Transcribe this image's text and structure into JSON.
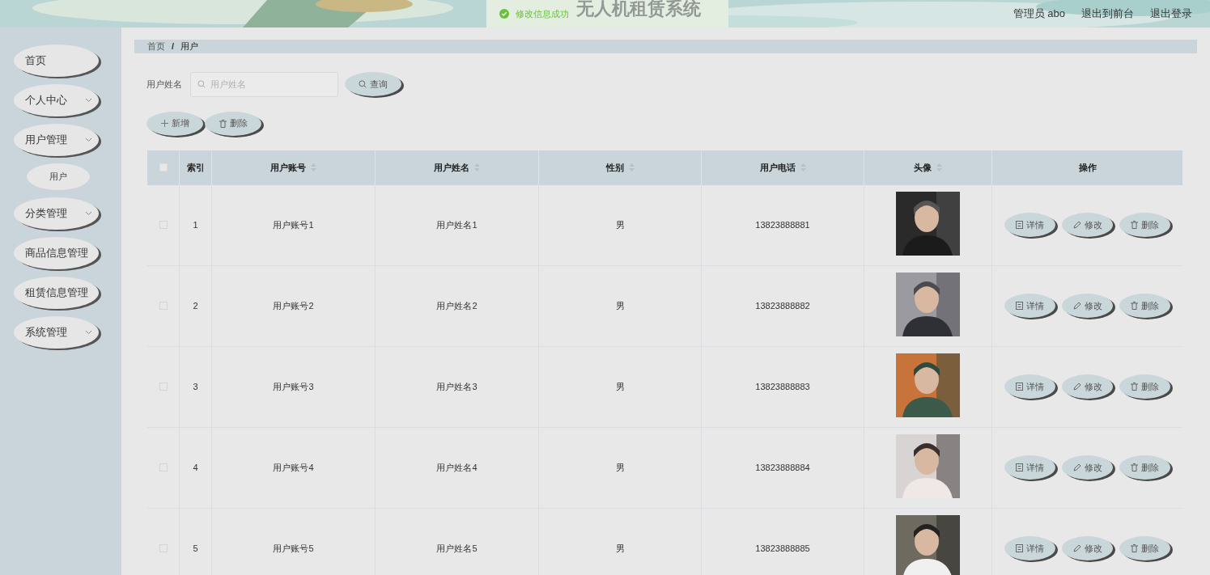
{
  "header": {
    "title": "无人机租赁系统",
    "toast": "修改信息成功",
    "links": [
      "管理员 abo",
      "退出到前台",
      "退出登录"
    ]
  },
  "sidebar": {
    "items": [
      {
        "label": "首页",
        "expandable": false
      },
      {
        "label": "个人中心",
        "expandable": true
      },
      {
        "label": "用户管理",
        "expandable": true,
        "children": [
          {
            "label": "用户"
          }
        ]
      },
      {
        "label": "分类管理",
        "expandable": true
      },
      {
        "label": "商品信息管理",
        "expandable": false
      },
      {
        "label": "租赁信息管理",
        "expandable": false
      },
      {
        "label": "系统管理",
        "expandable": true
      }
    ]
  },
  "breadcrumb": {
    "separator": "/",
    "items": [
      "首页",
      "用户"
    ]
  },
  "search": {
    "label": "用户姓名",
    "placeholder": "用户姓名",
    "button": "查询"
  },
  "actions": [
    "新增",
    "删除"
  ],
  "table": {
    "columns": [
      {
        "label": "索引",
        "sortable": false
      },
      {
        "label": "用户账号",
        "sortable": true
      },
      {
        "label": "用户姓名",
        "sortable": true
      },
      {
        "label": "性别",
        "sortable": true
      },
      {
        "label": "用户电话",
        "sortable": true
      },
      {
        "label": "头像",
        "sortable": true
      },
      {
        "label": "操作",
        "sortable": false
      }
    ],
    "all_checked": false,
    "rows": [
      {
        "index": "1",
        "account": "用户账号1",
        "name": "用户姓名1",
        "gender": "男",
        "phone": "13823888881",
        "checked": false,
        "buttons": [
          "详情",
          "修改",
          "删除"
        ]
      },
      {
        "index": "2",
        "account": "用户账号2",
        "name": "用户姓名2",
        "gender": "男",
        "phone": "13823888882",
        "checked": false,
        "buttons": [
          "详情",
          "修改",
          "删除"
        ]
      },
      {
        "index": "3",
        "account": "用户账号3",
        "name": "用户姓名3",
        "gender": "男",
        "phone": "13823888883",
        "checked": false,
        "buttons": [
          "详情",
          "修改",
          "删除"
        ]
      },
      {
        "index": "4",
        "account": "用户账号4",
        "name": "用户姓名4",
        "gender": "男",
        "phone": "13823888884",
        "checked": false,
        "buttons": [
          "详情",
          "修改",
          "删除"
        ]
      },
      {
        "index": "5",
        "account": "用户账号5",
        "name": "用户姓名5",
        "gender": "男",
        "phone": "13823888885",
        "checked": false,
        "buttons": [
          "详情",
          "修改",
          "删除"
        ]
      }
    ]
  }
}
